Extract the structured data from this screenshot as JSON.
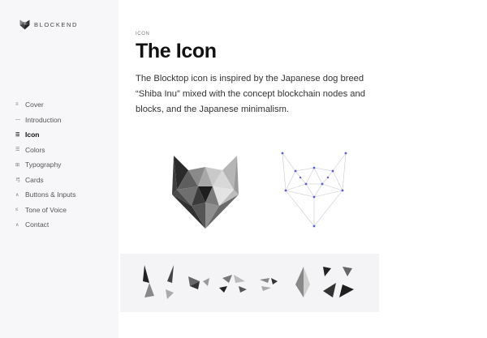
{
  "brand": {
    "name": "BLOCKEND",
    "logo_icon": "cat-head-logo-icon"
  },
  "nav": {
    "items": [
      {
        "label": "Cover",
        "icon": "cover-icon",
        "glyph": "≡",
        "active": false
      },
      {
        "label": "Introduction",
        "icon": "dash-icon",
        "glyph": "—",
        "active": false
      },
      {
        "label": "Icon",
        "icon": "icon-icon",
        "glyph": "☰",
        "active": true
      },
      {
        "label": "Colors",
        "icon": "colors-icon",
        "glyph": "☰",
        "active": false
      },
      {
        "label": "Typography",
        "icon": "typography-icon",
        "glyph": "⊞",
        "active": false
      },
      {
        "label": "Cards",
        "icon": "cards-icon",
        "glyph": "弓",
        "active": false
      },
      {
        "label": "Buttons & Inputs",
        "icon": "buttons-icon",
        "glyph": "∧",
        "active": false
      },
      {
        "label": "Tone of Voice",
        "icon": "tone-icon",
        "glyph": "≤",
        "active": false
      },
      {
        "label": "Contact",
        "icon": "contact-icon",
        "glyph": "∧",
        "active": false
      }
    ]
  },
  "main": {
    "eyebrow": "ICON",
    "title": "The Icon",
    "description": "The Blocktop icon is inspired by the Japanese dog breed “Shiba Inu” mixed with the concept blockchain nodes and blocks, and the Japanese minimalism."
  },
  "colors": {
    "sidebar_bg": "#f7f7f9",
    "parts_bg": "#f4f4f6",
    "node": "#5b5bd6",
    "text": "#222222"
  }
}
